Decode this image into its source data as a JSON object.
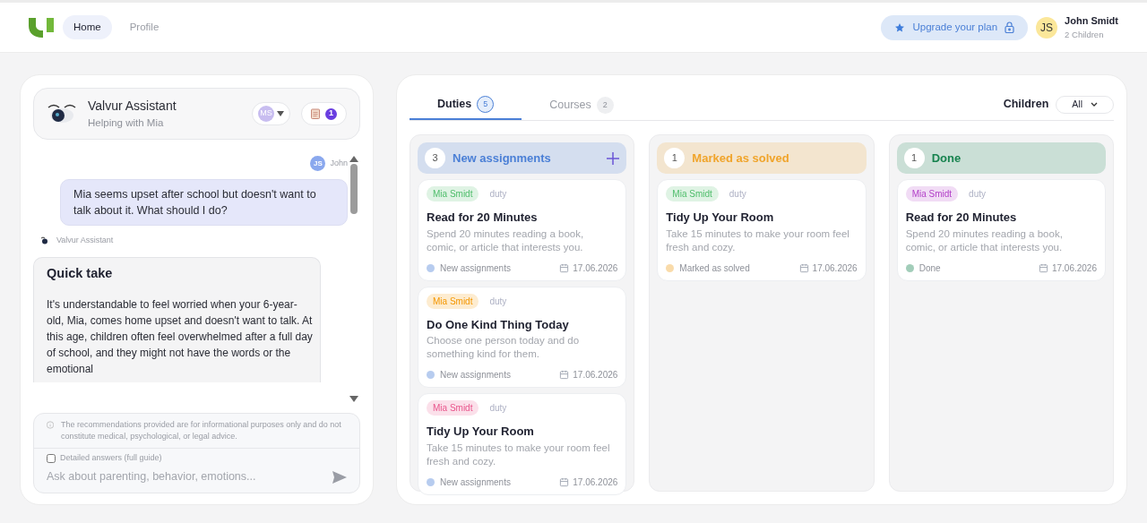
{
  "nav": [
    {
      "label": "Home",
      "selected": true
    },
    {
      "label": "Profile",
      "selected": false
    }
  ],
  "upgrade": {
    "label": "Upgrade your plan"
  },
  "user": {
    "initials": "JS",
    "name": "John Smidt",
    "subtitle": "2 Children"
  },
  "assistant": {
    "title": "Valvur Assistant",
    "subtitle": "Helping with Mia",
    "child_initials": "MS",
    "notes_count": "1",
    "messages": [
      {
        "kind": "user",
        "initials": "JS",
        "author": "John",
        "text": "Mia seems upset after school but doesn't want to talk about it. What should I do?"
      },
      {
        "kind": "bot",
        "author": "Valvur Assistant",
        "heading": "Quick take",
        "text": "It's understandable to feel worried when your 6-year-old, Mia, comes home upset and doesn't want to talk. At this age, children often feel overwhelmed after a full day of school, and they might not have the words or the emotional"
      }
    ],
    "disclaimer": "The recommendations provided are for informational purposes only and do not constitute medical, psychological, or legal advice.",
    "detailed": {
      "label": "Detailed answers (full guide)",
      "checked": false
    },
    "placeholder": "Ask about parenting, behavior, emotions..."
  },
  "tabs": [
    {
      "label": "Duties",
      "count": "5",
      "selected": true
    },
    {
      "label": "Courses",
      "count": "2",
      "selected": false
    }
  ],
  "filter": {
    "label": "Children",
    "value": "All"
  },
  "columns": [
    {
      "count": "3",
      "title": "New assignments",
      "color": "#4a7fd6",
      "addable": true,
      "cards": [
        {
          "tag": "Mia Smidt",
          "color": "#dff3e4",
          "type": "duty",
          "title": "Read for 20 Minutes",
          "text": "Spend 20 minutes reading a book, comic, or article that interests you.",
          "status": "New assignments",
          "date": "17.06.2026"
        },
        {
          "tag": "Mia Smidt",
          "color": "#fdecd0",
          "type": "duty",
          "title": "Do One Kind Thing Today",
          "text": "Choose one person today and do something kind for them.",
          "status": "New assignments",
          "date": "17.06.2026"
        },
        {
          "tag": "Mia Smidt",
          "color": "#fbe0ea",
          "type": "duty",
          "title": "Tidy Up Your Room",
          "text": "Take 15 minutes to make your room feel fresh and cozy.",
          "status": "New assignments",
          "date": "17.06.2026"
        }
      ]
    },
    {
      "count": "1",
      "title": "Marked as solved",
      "color": "#f0a42a",
      "addable": false,
      "cards": [
        {
          "tag": "Mia Smidt",
          "color": "#dff3e4",
          "type": "duty",
          "title": "Tidy Up Your Room",
          "text": "Take 15 minutes to make your room feel fresh and cozy.",
          "status": "Marked as solved",
          "date": "17.06.2026"
        }
      ]
    },
    {
      "count": "1",
      "title": "Done",
      "color": "#17834f",
      "addable": false,
      "cards": [
        {
          "tag": "Mia Smidt",
          "color": "#f1dcf5",
          "type": "duty",
          "title": "Read for 20 Minutes",
          "text": "Spend 20 minutes reading a book, comic, or article that interests you.",
          "status": "Done",
          "date": "17.06.2026"
        }
      ]
    }
  ]
}
